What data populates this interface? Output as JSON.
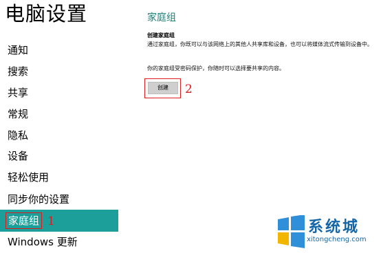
{
  "sidebar": {
    "title": "电脑设置",
    "items": [
      {
        "label": "通知"
      },
      {
        "label": "搜索"
      },
      {
        "label": "共享"
      },
      {
        "label": "常规"
      },
      {
        "label": "隐私"
      },
      {
        "label": "设备"
      },
      {
        "label": "轻松使用"
      },
      {
        "label": "同步你的设置"
      },
      {
        "label": "家庭组"
      },
      {
        "label": "Windows 更新"
      }
    ],
    "selected_index": 8,
    "selected_color": "#1c9e9b"
  },
  "main": {
    "title": "家庭组",
    "create_heading": "创建家庭组",
    "description": "通过家庭组，你既可以与该网络上的其他人共享库和设备，也可以将媒体流式传输到设备中。",
    "password_note": "你的家庭组受密码保护，你随时可以选择要共享的内容。",
    "create_button_label": "创建"
  },
  "annotations": {
    "step1": "1",
    "step2": "2",
    "color": "#e01b1b"
  },
  "watermark": {
    "name": "系统城",
    "url": "xitongcheng.com",
    "icon": "windows-logo-icon"
  }
}
